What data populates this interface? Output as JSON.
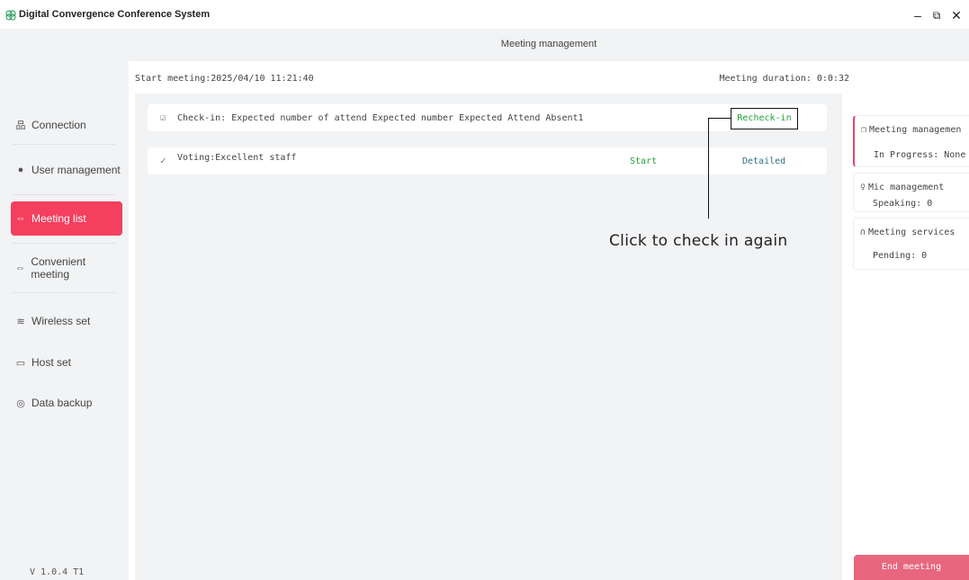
{
  "window": {
    "title": "Digital Convergence Conference System",
    "minimize": "–",
    "maximize": "⧉",
    "close": "✕"
  },
  "sidebar": {
    "items": [
      {
        "icon": "connection-icon",
        "glyph": "品",
        "label": "Connection"
      },
      {
        "icon": "user-icon",
        "glyph": "●",
        "label": "User management"
      },
      {
        "icon": "meeting-icon",
        "glyph": "⇔",
        "label": "Meeting list"
      },
      {
        "icon": "convenient-meeting-icon",
        "glyph": "⇔",
        "label": "Convenient meeting"
      },
      {
        "icon": "wifi-icon",
        "glyph": "≋",
        "label": "Wireless set"
      },
      {
        "icon": "host-icon",
        "glyph": "▭",
        "label": "Host set"
      },
      {
        "icon": "backup-icon",
        "glyph": "◎",
        "label": "Data backup"
      }
    ],
    "active": "Meeting list",
    "version": "V 1.0.4 T1"
  },
  "header": {
    "title": "Meeting management"
  },
  "meeting": {
    "start": "Start meeting:2025/04/10 11:21:40",
    "duration": "Meeting duration: 0:0:32"
  },
  "cards": {
    "checkin": {
      "text": "Check-in: Expected number of attend Expected number Expected Attend Absent1",
      "action": "Recheck-in"
    },
    "voting": {
      "text": "Voting:Excellent staff",
      "start": "Start",
      "detailed": "Detailed"
    }
  },
  "annotation": {
    "text": "Click to check in again"
  },
  "right_panel": {
    "meeting_management": {
      "title": "Meeting managemen",
      "value": "In Progress: None"
    },
    "mic_management": {
      "title": "Mic management",
      "value": "Speaking: 0"
    },
    "meeting_services": {
      "title": "Meeting services",
      "value": "Pending: 0"
    },
    "end_button": "End meeting"
  },
  "colors": {
    "accent": "#f43f5e",
    "end_button": "#e8677f",
    "action_green": "#22a039",
    "detail_blue": "#2f6f86"
  }
}
